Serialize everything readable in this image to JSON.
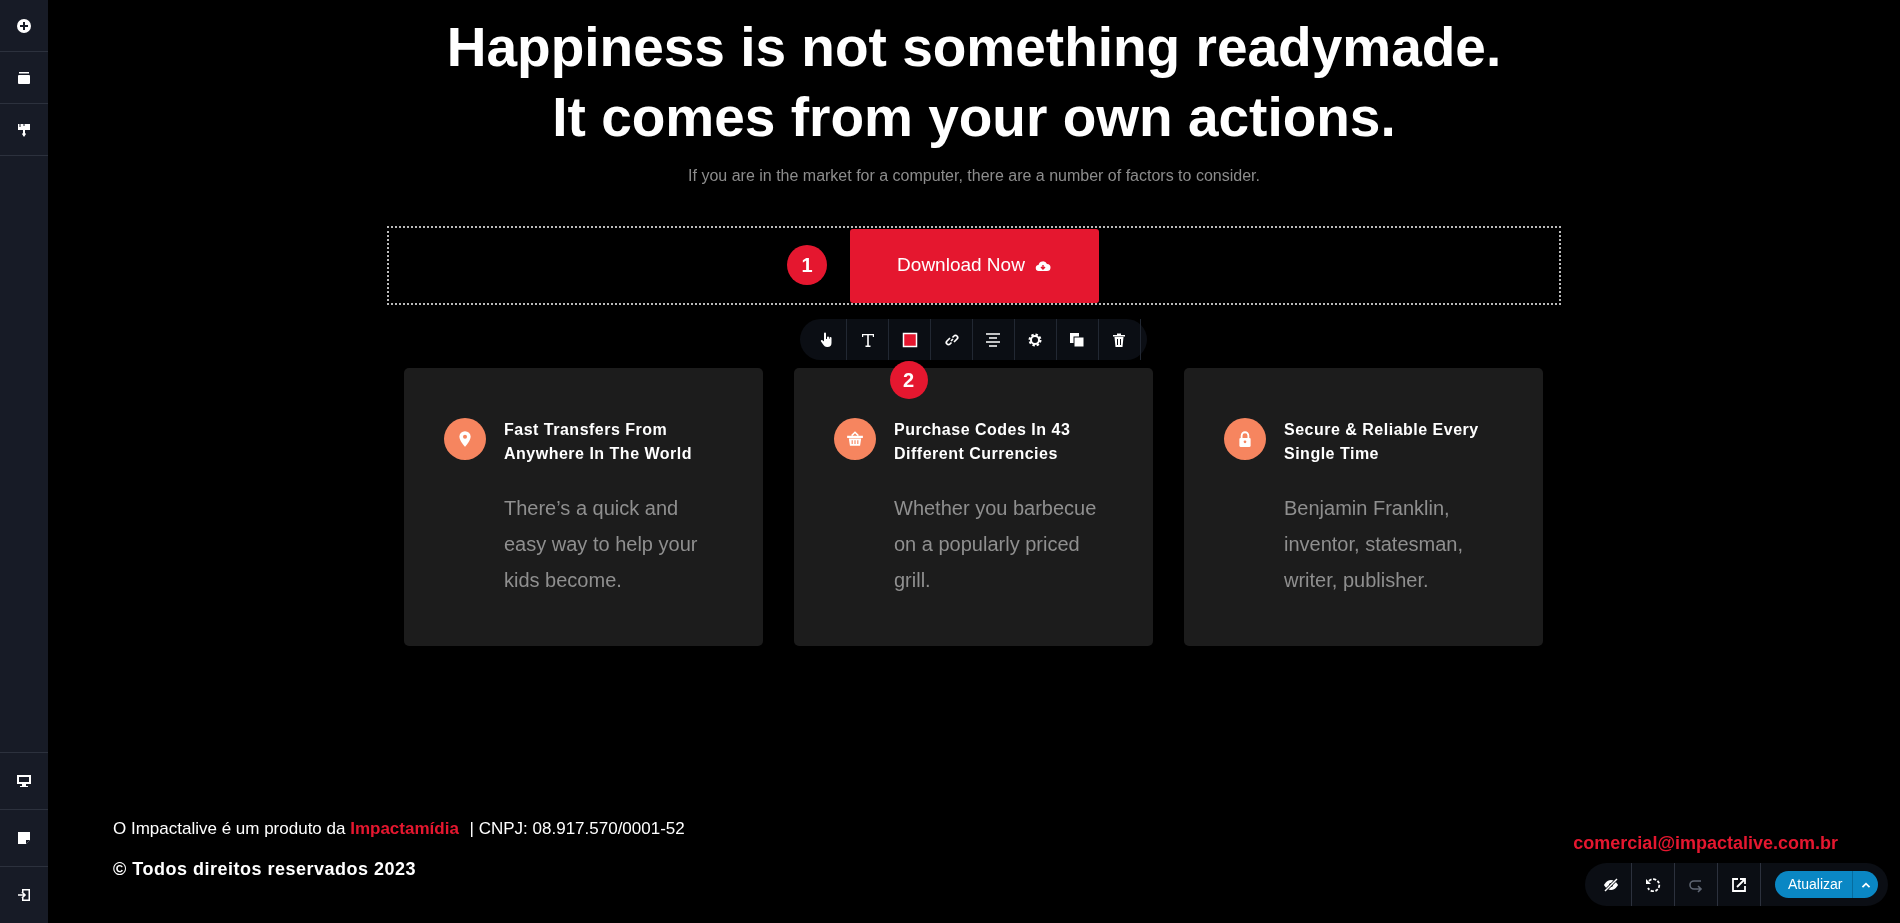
{
  "heading": [
    "Happiness is not something readymade.",
    "It comes from your own actions."
  ],
  "subtitle": "If you are in the market for a computer, there are a number of factors to consider.",
  "cta": {
    "label": "Download Now",
    "badge": "1"
  },
  "toolbar": {
    "badge": "2"
  },
  "features": [
    {
      "kind": "pin",
      "title": "Fast Transfers From Anywhere In The World",
      "body": "There’s a quick and easy way to help your kids become."
    },
    {
      "kind": "basket",
      "title": "Purchase Codes In 43 Different Currencies",
      "body": "Whether you barbecue on a popularly priced grill."
    },
    {
      "kind": "lock",
      "title": "Secure & Reliable Every Single Time",
      "body": "Benjamin Franklin, inventor, statesman, writer, publisher."
    }
  ],
  "footer": {
    "text_before": "O Impactalive é um produto da",
    "link": "Impactamídia",
    "text_after": "| CNPJ: 08.917.570/0001-52",
    "copyright": "© Todos direitos reservados 2023",
    "email": "comercial@impactalive.com.br"
  },
  "bottom_toolbar": {
    "tools": [
      {
        "kind": "hide",
        "disabled": false
      },
      {
        "kind": "undo",
        "disabled": false
      },
      {
        "kind": "redo",
        "disabled": true
      },
      {
        "kind": "open",
        "disabled": false
      }
    ],
    "button": "Atualizar"
  }
}
